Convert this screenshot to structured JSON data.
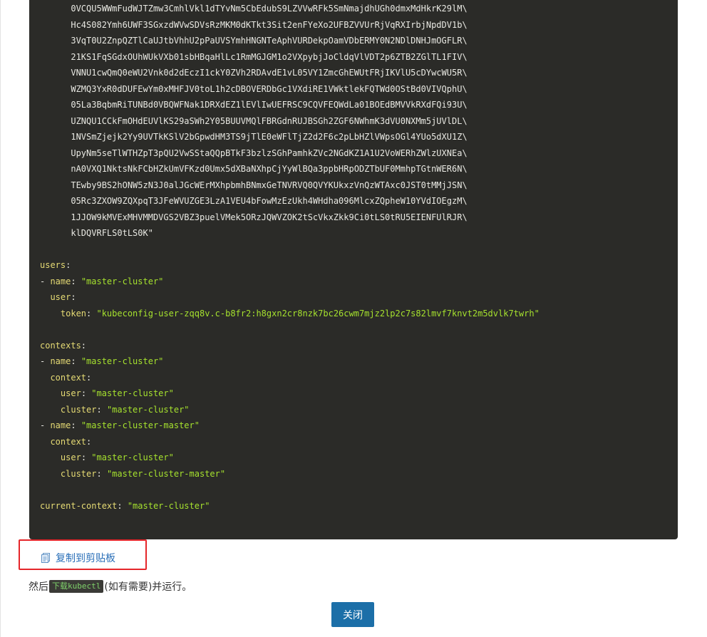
{
  "code": {
    "background": "#2b2b28",
    "key_color": "#e6db74",
    "string_color": "#a6e22e",
    "lines": [
      {
        "indent": "      ",
        "parts": [
          {
            "t": "cert",
            "v": "0VCQU5WWmFudWJTZmw3CmhlVkl1dTYvNm5CbEdubS9LZVVwRFk5SmNmajdhUGh0dmxMdHkrK29lM\\"
          }
        ]
      },
      {
        "indent": "      ",
        "parts": [
          {
            "t": "cert",
            "v": "Hc4S082Ymh6UWF3SGxzdWVwSDVsRzMKM0dKTkt3Sit2enFYeXo2UFBZVVUrRjVqRXIrbjNpdDV1b\\"
          }
        ]
      },
      {
        "indent": "      ",
        "parts": [
          {
            "t": "cert",
            "v": "3VqT0U2ZnpQZTlCaUJtbVhhU2pPaUVSYmhHNGNTeAphVURDekpOamVDbERMY0N2NDlDNHJmOGFLR\\"
          }
        ]
      },
      {
        "indent": "      ",
        "parts": [
          {
            "t": "cert",
            "v": "21KS1FqSGdxOUhWUkVXb01sbHBqaHlLc1RmMGJGM1o2VXpybjJoCldqVlVDT2p6ZTB2ZGlTL1FIV\\"
          }
        ]
      },
      {
        "indent": "      ",
        "parts": [
          {
            "t": "cert",
            "v": "VNNU1cwQmQ0eWU2Vnk0d2dEczI1ckY0ZVh2RDAvdE1vL05VY1ZmcGhEWUtFRjIKVlU5cDYwcWU5R\\"
          }
        ]
      },
      {
        "indent": "      ",
        "parts": [
          {
            "t": "cert",
            "v": "WZMQ3YxR0dDUFEwYm0xMHFJV0toL1h2cDBOVERDbGc1VXdiRE1VWktlekFQTWd0OStBd0VIVQphU\\"
          }
        ]
      },
      {
        "indent": "      ",
        "parts": [
          {
            "t": "cert",
            "v": "05La3BqbmRiTUNBd0VBQWFNak1DRXdEZ1lEVlIwUEFRSC9CQVFEQWdLa01BOEdBMVVkRXdFQi93U\\"
          }
        ]
      },
      {
        "indent": "      ",
        "parts": [
          {
            "t": "cert",
            "v": "UZNQU1CCkFmOHdEUVlKS29aSWh2Y05BUUVMQlFBRGdnRUJBSGh2ZGF6NWhmK3dVU0NXMm5jUVlDL\\"
          }
        ]
      },
      {
        "indent": "      ",
        "parts": [
          {
            "t": "cert",
            "v": "1NVSmZjejk2Yy9UVTkKSlV2bGpwdHM3TS9jTlE0eWFlTjZ2d2F6c2pLbHZlVWpsOGl4YUo5dXU1Z\\"
          }
        ]
      },
      {
        "indent": "      ",
        "parts": [
          {
            "t": "cert",
            "v": "UpyNm5seTlWTHZpT3pQU2VwSStaQQpBTkF3bzlzSGhPamhkZVc2NGdKZ1A1U2VoWERhZWlzUXNEa\\"
          }
        ]
      },
      {
        "indent": "      ",
        "parts": [
          {
            "t": "cert",
            "v": "nA0VXQ1NktsNkFCbHZkUmVFKzd0Umx5dXBaNXhpCjYyWlBQa3ppbHRpODZTbUF0MmhpTGtnWER6N\\"
          }
        ]
      },
      {
        "indent": "      ",
        "parts": [
          {
            "t": "cert",
            "v": "TEwby9BS2hONW5zN3J0alJGcWErMXhpbmhBNmxGeTNVRVQ0QVYKUkxzVnQzWTAxc0JST0tMMjJSN\\"
          }
        ]
      },
      {
        "indent": "      ",
        "parts": [
          {
            "t": "cert",
            "v": "05Rc3ZXOW9ZQXpqT3JFeWVUZGE3LzA1VEU4bFowMzEzUkh4WHdha096MlcxZQpheW10YVdIOEgzM\\"
          }
        ]
      },
      {
        "indent": "      ",
        "parts": [
          {
            "t": "cert",
            "v": "1JJOW9kMVExMHVMMDVGS2VBZ3puelVMek5ORzJQWVZOK2tScVkxZkk9Ci0tLS0tRU5EIENFUlRJR\\"
          }
        ]
      },
      {
        "indent": "      ",
        "parts": [
          {
            "t": "cert",
            "v": "klDQVRFLS0tLS0K\""
          }
        ]
      },
      {
        "indent": "",
        "parts": []
      },
      {
        "indent": "",
        "parts": [
          {
            "t": "key",
            "v": "users"
          },
          {
            "t": "plain",
            "v": ":"
          }
        ]
      },
      {
        "indent": "",
        "parts": [
          {
            "t": "plain",
            "v": "- "
          },
          {
            "t": "key",
            "v": "name"
          },
          {
            "t": "plain",
            "v": ": "
          },
          {
            "t": "str",
            "v": "\"master-cluster\""
          }
        ]
      },
      {
        "indent": "  ",
        "parts": [
          {
            "t": "key",
            "v": "user"
          },
          {
            "t": "plain",
            "v": ":"
          }
        ]
      },
      {
        "indent": "    ",
        "parts": [
          {
            "t": "key",
            "v": "token"
          },
          {
            "t": "plain",
            "v": ": "
          },
          {
            "t": "str",
            "v": "\"kubeconfig-user-zqq8v.c-b8fr2:h8gxn2cr8nzk7bc26cwm7mjz2lp2c7s82lmvf7knvt2m5dvlk7twrh\""
          }
        ]
      },
      {
        "indent": "",
        "parts": []
      },
      {
        "indent": "",
        "parts": [
          {
            "t": "key",
            "v": "contexts"
          },
          {
            "t": "plain",
            "v": ":"
          }
        ]
      },
      {
        "indent": "",
        "parts": [
          {
            "t": "plain",
            "v": "- "
          },
          {
            "t": "key",
            "v": "name"
          },
          {
            "t": "plain",
            "v": ": "
          },
          {
            "t": "str",
            "v": "\"master-cluster\""
          }
        ]
      },
      {
        "indent": "  ",
        "parts": [
          {
            "t": "key",
            "v": "context"
          },
          {
            "t": "plain",
            "v": ":"
          }
        ]
      },
      {
        "indent": "    ",
        "parts": [
          {
            "t": "key",
            "v": "user"
          },
          {
            "t": "plain",
            "v": ": "
          },
          {
            "t": "str",
            "v": "\"master-cluster\""
          }
        ]
      },
      {
        "indent": "    ",
        "parts": [
          {
            "t": "key",
            "v": "cluster"
          },
          {
            "t": "plain",
            "v": ": "
          },
          {
            "t": "str",
            "v": "\"master-cluster\""
          }
        ]
      },
      {
        "indent": "",
        "parts": [
          {
            "t": "plain",
            "v": "- "
          },
          {
            "t": "key",
            "v": "name"
          },
          {
            "t": "plain",
            "v": ": "
          },
          {
            "t": "str",
            "v": "\"master-cluster-master\""
          }
        ]
      },
      {
        "indent": "  ",
        "parts": [
          {
            "t": "key",
            "v": "context"
          },
          {
            "t": "plain",
            "v": ":"
          }
        ]
      },
      {
        "indent": "    ",
        "parts": [
          {
            "t": "key",
            "v": "user"
          },
          {
            "t": "plain",
            "v": ": "
          },
          {
            "t": "str",
            "v": "\"master-cluster\""
          }
        ]
      },
      {
        "indent": "    ",
        "parts": [
          {
            "t": "key",
            "v": "cluster"
          },
          {
            "t": "plain",
            "v": ": "
          },
          {
            "t": "str",
            "v": "\"master-cluster-master\""
          }
        ]
      },
      {
        "indent": "",
        "parts": []
      },
      {
        "indent": "",
        "parts": [
          {
            "t": "key",
            "v": "current-context"
          },
          {
            "t": "plain",
            "v": ": "
          },
          {
            "t": "str",
            "v": "\"master-cluster\""
          }
        ]
      }
    ]
  },
  "copy": {
    "label": "复制到剪贴板",
    "icon": "clipboard-icon",
    "link_color": "#2a6fb8",
    "highlight_color": "#e5262a"
  },
  "hint": {
    "prefix": "然后",
    "link": "下载kubectl",
    "suffix": "(如有需要)并运行。"
  },
  "close_button": {
    "label": "关闭",
    "color": "#1c6fa8"
  }
}
